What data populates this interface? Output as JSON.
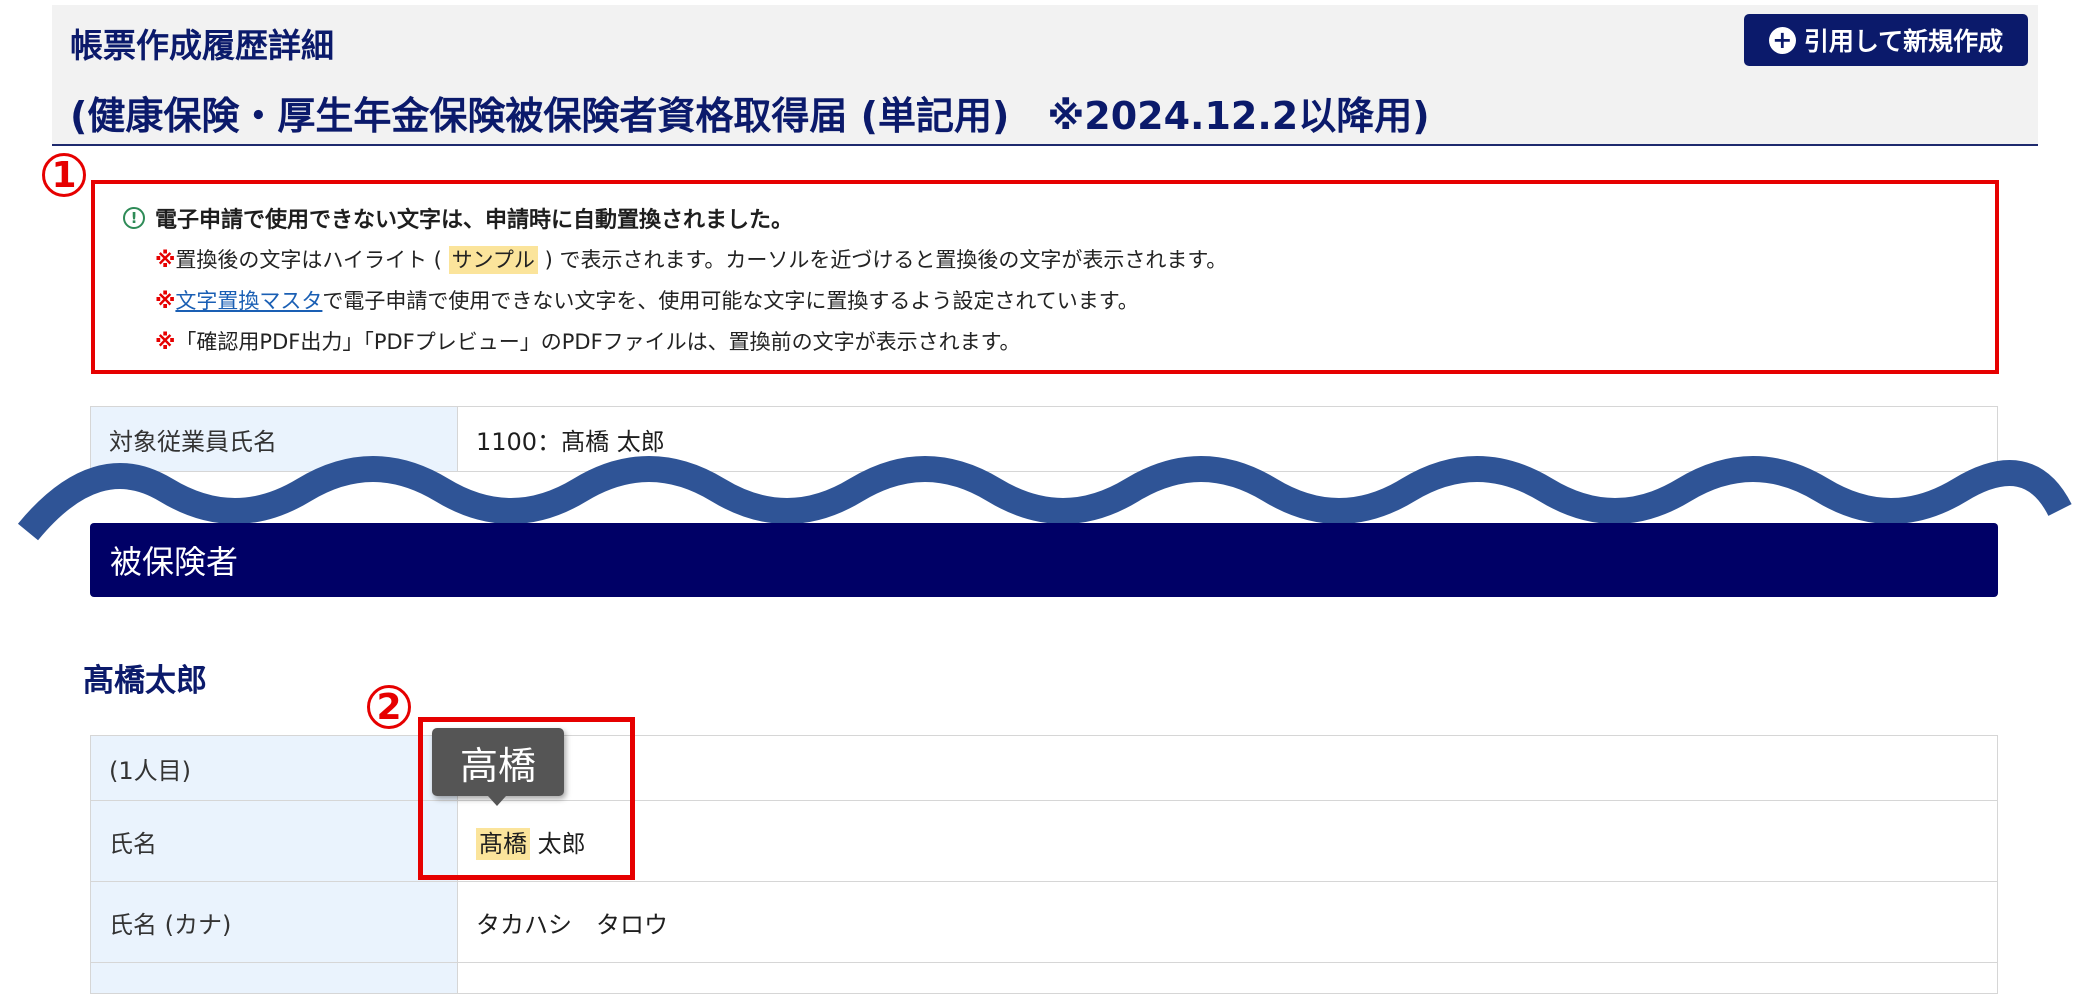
{
  "header": {
    "title": "帳票作成履歴詳細",
    "subtitle": "(健康保険・厚生年金保険被保険者資格取得届 (単記用)　※2024.12.2以降用)",
    "cite_button_label": "引用して新規作成"
  },
  "markers": {
    "m1": "1",
    "m2": "2"
  },
  "notice": {
    "title": "電子申請で使用できない文字は、申請時に自動置換されました。",
    "kome": "※",
    "line1_pre": "置換後の文字はハイライト (",
    "line1_hl": "サンプル",
    "line1_post": ") で表示されます。カーソルを近づけると置換後の文字が表示されます。",
    "line2_link": "文字置換マスタ",
    "line2_post": "で電子申請で使用できない文字を、使用可能な文字に置換するよう設定されています。",
    "line3": "「確認用PDF出力」「PDFプレビュー」のPDFファイルは、置換前の文字が表示されます。"
  },
  "employee": {
    "label": "対象従業員氏名",
    "value": "1100：髙橋 太郎"
  },
  "section": {
    "title": "被保険者"
  },
  "person": {
    "heading": "髙橋太郎"
  },
  "tooltip": {
    "text": "高橋"
  },
  "details": {
    "row1_label": "(1人目)",
    "row2_label": "氏名",
    "row2_hl": "髙橋",
    "row2_rest": "太郎",
    "row3_label": "氏名 (カナ)",
    "row3_value": "タカハシ　タロウ"
  },
  "colors": {
    "navy": "#0b1a6b",
    "section_bg": "#000066",
    "highlight": "#fbe49b",
    "annotation_red": "#e60000",
    "wave": "#2f5496"
  }
}
